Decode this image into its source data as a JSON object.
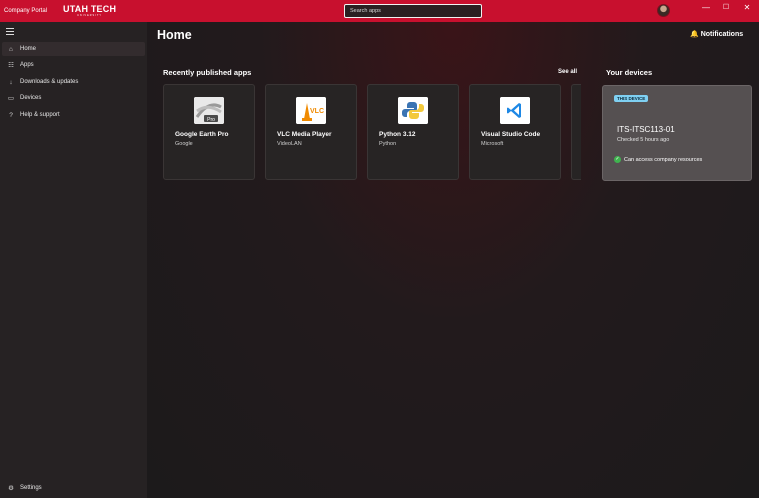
{
  "titlebar": {
    "app_title": "Company Portal",
    "logo_main": "UTAH TECH",
    "logo_sub": "UNIVERSITY",
    "search_placeholder": "Search apps",
    "minimize": "—",
    "maximize": "☐",
    "close": "✕"
  },
  "sidebar": {
    "items": [
      {
        "label": "Home",
        "icon": "home-icon"
      },
      {
        "label": "Apps",
        "icon": "apps-icon"
      },
      {
        "label": "Downloads & updates",
        "icon": "download-icon"
      },
      {
        "label": "Devices",
        "icon": "device-icon"
      },
      {
        "label": "Help & support",
        "icon": "help-icon"
      }
    ],
    "settings_label": "Settings"
  },
  "main": {
    "title": "Home",
    "notifications_label": "Notifications",
    "recent_title": "Recently published apps",
    "see_all": "See all",
    "apps": [
      {
        "name": "Google Earth Pro",
        "publisher": "Google",
        "icon": "google-earth-pro-icon"
      },
      {
        "name": "VLC Media Player",
        "publisher": "VideoLAN",
        "icon": "vlc-icon"
      },
      {
        "name": "Python 3.12",
        "publisher": "Python",
        "icon": "python-icon"
      },
      {
        "name": "Visual Studio Code",
        "publisher": "Microsoft",
        "icon": "vscode-icon"
      }
    ],
    "devices_title": "Your devices",
    "device": {
      "badge": "THIS DEVICE",
      "name": "ITS-ITSC113-01",
      "checked": "Checked 5 hours ago",
      "status": "Can access company resources"
    }
  },
  "colors": {
    "brand_red": "#c8102e",
    "status_green": "#3fb34f",
    "badge_blue": "#7fd0f2"
  }
}
